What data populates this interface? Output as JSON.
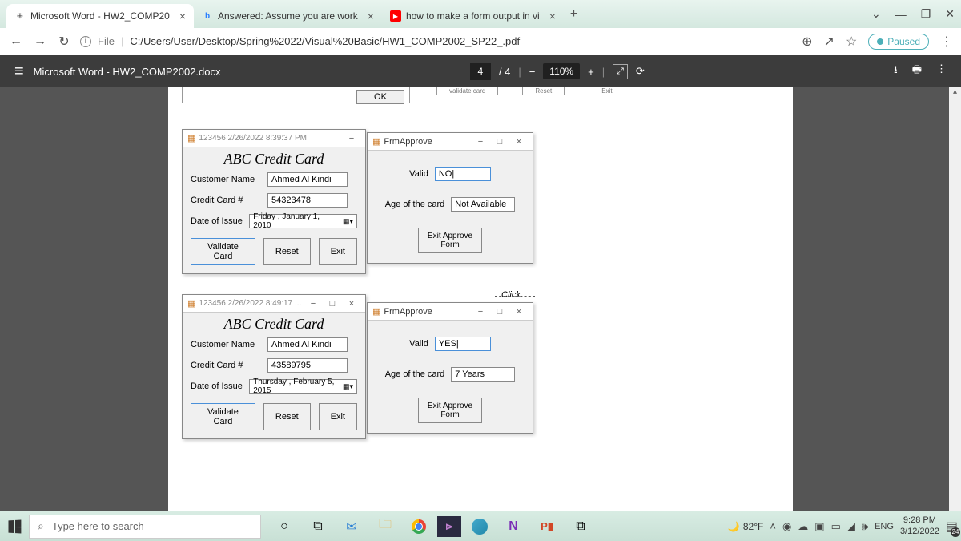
{
  "browser": {
    "tabs": [
      {
        "icon": "⊕",
        "label": "Microsoft Word - HW2_COMP20"
      },
      {
        "icon": "b",
        "icon_color": "#2a7fff",
        "label": "Answered: Assume you are work"
      },
      {
        "icon": "▶",
        "icon_bg": "#ff0000",
        "label": "how to make a form output in vi"
      }
    ],
    "url_prefix": "File",
    "url": "C:/Users/User/Desktop/Spring%2022/Visual%20Basic/HW1_COMP2002_SP22_.pdf",
    "paused": "Paused"
  },
  "pdf": {
    "filename": "Microsoft Word - HW2_COMP2002.docx",
    "page_current": "4",
    "page_total": "/ 4",
    "zoom": "110%"
  },
  "ok_button": "OK",
  "form1": {
    "title": "123456  2/26/2022 8:39:37 PM",
    "heading": "ABC Credit Card",
    "name_label": "Customer Name",
    "name_value": "Ahmed Al Kindi",
    "cc_label": "Credit Card #",
    "cc_value": "54323478",
    "date_label": "Date of Issue",
    "date_value": "Friday   ,  January    1, 2010",
    "btn_validate": "Validate Card",
    "btn_reset": "Reset",
    "btn_exit": "Exit"
  },
  "approve1": {
    "title": "FrmApprove",
    "valid_label": "Valid",
    "valid_value": "NO|",
    "age_label": "Age of the card",
    "age_value": "Not Available",
    "exit_btn": "Exit Approve Form"
  },
  "form2": {
    "title": "123456  2/26/2022 8:49:17 ...",
    "heading": "ABC Credit Card",
    "name_label": "Customer Name",
    "name_value": "Ahmed Al Kindi",
    "cc_label": "Credit Card #",
    "cc_value": "43589795",
    "date_label": "Date of Issue",
    "date_value": "Thursday , February   5, 2015",
    "btn_validate": "Validate Card",
    "btn_reset": "Reset",
    "btn_exit": "Exit"
  },
  "approve2": {
    "title": "FrmApprove",
    "valid_label": "Valid",
    "valid_value": "YES|",
    "age_label": "Age of the card",
    "age_value": "7 Years",
    "exit_btn": "Exit Approve Form"
  },
  "click_label": "Click",
  "taskbar": {
    "search": "Type here to search",
    "weather": "82°F",
    "lang": "ENG",
    "time": "9:28 PM",
    "date": "3/12/2022",
    "notif_count": "24"
  }
}
